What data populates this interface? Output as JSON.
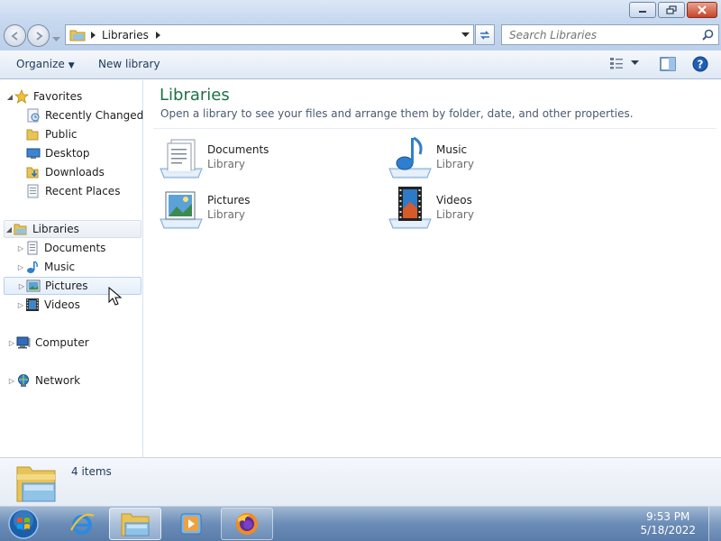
{
  "window": {
    "controls": [
      "minimize",
      "maximize",
      "close"
    ]
  },
  "address": {
    "breadcrumb": "Libraries",
    "search_placeholder": "Search Libraries"
  },
  "command_bar": {
    "organize_label": "Organize",
    "new_library_label": "New library"
  },
  "nav": {
    "favorites": "Favorites",
    "favorites_items": [
      "Recently Changed",
      "Public",
      "Desktop",
      "Downloads",
      "Recent Places"
    ],
    "libraries": "Libraries",
    "libraries_items": [
      "Documents",
      "Music",
      "Pictures",
      "Videos"
    ],
    "computer": "Computer",
    "network": "Network"
  },
  "content": {
    "title": "Libraries",
    "subtitle": "Open a library to see your files and arrange them by folder, date, and other properties.",
    "items": [
      {
        "name": "Documents",
        "type": "Library",
        "icon": "documents-library-icon"
      },
      {
        "name": "Music",
        "type": "Library",
        "icon": "music-library-icon"
      },
      {
        "name": "Pictures",
        "type": "Library",
        "icon": "pictures-library-icon"
      },
      {
        "name": "Videos",
        "type": "Library",
        "icon": "videos-library-icon"
      }
    ]
  },
  "details": {
    "count": "4 items"
  },
  "taskbar": {
    "time": "9:53 PM",
    "date": "5/18/2022"
  },
  "colors": {
    "title_green": "#1e7145",
    "taskbar_blue": "#6b8cb6"
  }
}
